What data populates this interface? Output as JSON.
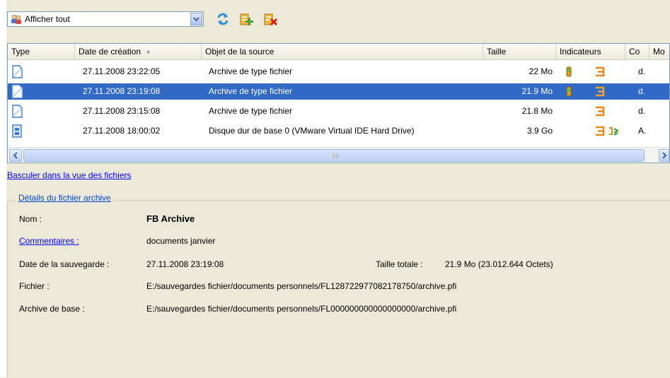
{
  "toolbar": {
    "filter_value": "Afficher tout",
    "buttons": [
      {
        "name": "refresh-icon"
      },
      {
        "name": "add-archive-icon"
      },
      {
        "name": "delete-archive-icon"
      }
    ]
  },
  "columns": [
    "Type",
    "Date de création",
    "Objet de la source",
    "Taille",
    "Indicateurs",
    "Co",
    "Mo"
  ],
  "rows": [
    {
      "type_icon": "file-archive-icon",
      "date": "27.11.2008 23:22:05",
      "source": "Archive de type fichier",
      "size": "22 Mo",
      "co": "d.",
      "selected": false
    },
    {
      "type_icon": "file-archive-icon",
      "date": "27.11.2008 23:19:08",
      "source": "Archive de type fichier",
      "size": "21.9 Mo",
      "co": "d.",
      "selected": true
    },
    {
      "type_icon": "file-archive-icon",
      "date": "27.11.2008 23:15:08",
      "source": "Archive de type fichier",
      "size": "21.8 Mo",
      "co": "d.",
      "selected": false
    },
    {
      "type_icon": "disk-archive-icon",
      "date": "27.11.2008 18:00:02",
      "source": "Disque dur de base 0 (VMware Virtual IDE Hard Drive)",
      "size": "3.9 Go",
      "co": "A.",
      "selected": false
    }
  ],
  "toggle_link": "Basculer dans la vue des fichiers",
  "details": {
    "title": "Détails du fichier archive",
    "name_label": "Nom :",
    "name_value": "FB Archive",
    "comments_label": "Commentaires :",
    "comments_value": "documents janvier",
    "date_label": "Date de la sauvegarde :",
    "date_value": "27.11.2008 23:19:08",
    "total_size_label": "Taille totale :",
    "total_size_value": "21.9 Mo (23.012.644 Octets)",
    "file_label": "Fichier :",
    "file_value": "E:/sauvegardes fichier/documents personnels/FL128722977082178750/archive.pfi",
    "base_label": "Archive de base :",
    "base_value": "E:/sauvegardes fichier/documents personnels/FL000000000000000000/archive.pfi"
  },
  "colors": {
    "selection": "#316ac5",
    "link": "#0000ff",
    "background": "#ece9d8"
  }
}
